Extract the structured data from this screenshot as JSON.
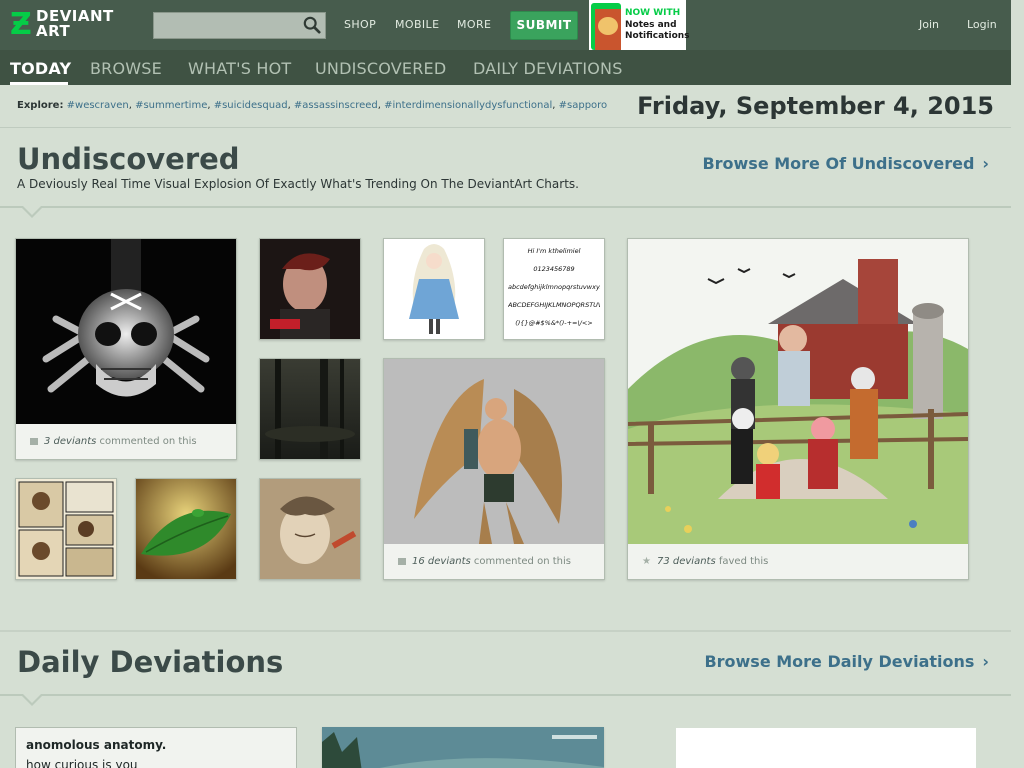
{
  "header": {
    "logo_top": "DEVIANT",
    "logo_bottom": "ART",
    "logo_mark": "Ƶ",
    "search_placeholder": "",
    "nav": [
      "SHOP",
      "MOBILE",
      "MORE"
    ],
    "submit_label": "SUBMIT",
    "promo": {
      "now_with": "NOW WITH",
      "line1": "Notes and",
      "line2": "Notifications"
    },
    "join_label": "Join",
    "login_label": "Login"
  },
  "subnav": {
    "items": [
      "TODAY",
      "BROWSE",
      "WHAT'S HOT",
      "UNDISCOVERED",
      "DAILY DEVIATIONS"
    ],
    "active": "TODAY"
  },
  "explore": {
    "label": "Explore:",
    "tags": [
      "#wescraven",
      "#summertime",
      "#suicidesquad",
      "#assassinscreed",
      "#interdimensionallydysfunctional",
      "#sapporo"
    ]
  },
  "date": "Friday, September 4, 2015",
  "undiscovered": {
    "title": "Undiscovered",
    "subtitle": "A Deviously Real Time Visual Explosion Of Exactly What's Trending On The DeviantArt Charts.",
    "browse_more": "Browse More Of Undiscovered",
    "cards": [
      {
        "who": "3 deviants",
        "action": "commented on this"
      },
      {
        "who": "16 deviants",
        "action": "commented on this"
      },
      {
        "who": "73 deviants",
        "action": "faved this"
      }
    ],
    "font_sample": {
      "line1": "Hi I'm kthelimiel",
      "line2": "0123456789",
      "line3": "abcdefghijklmnopqrstuvwxyz",
      "line4": "ABCDEFGHIJKLMNOPQRSTUVW",
      "line5": "(){}@#$%&*()-+=\\/<>"
    }
  },
  "daily": {
    "title": "Daily Deviations",
    "browse_more": "Browse More Daily Deviations",
    "card_title": "anomolous anatomy.",
    "card_text": "how curious is you"
  },
  "colors": {
    "header_bg": "#475c4d",
    "subnav_bg": "#3f5243",
    "page_bg": "#d5dfd3",
    "accent_green": "#05cc47",
    "submit_green": "#3aa35d",
    "link_blue": "#3d708a"
  }
}
